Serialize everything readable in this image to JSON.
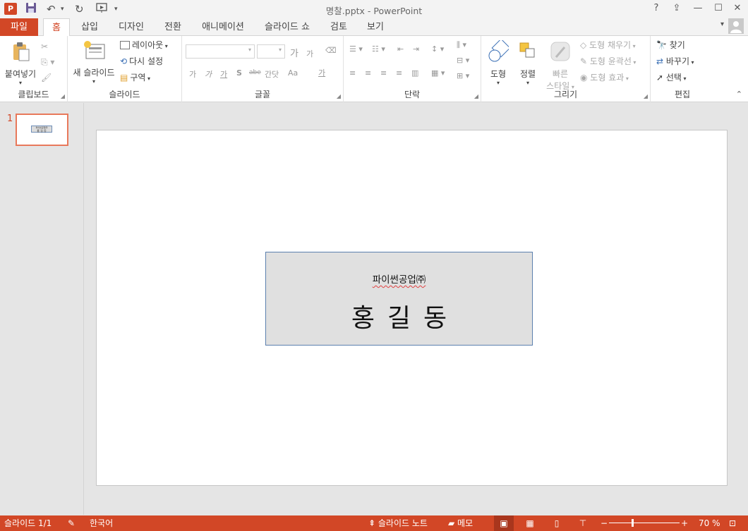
{
  "window": {
    "title": "명찰.pptx - PowerPoint",
    "help": "?",
    "restore_ribbon": "⇪",
    "minimize": "—",
    "maximize": "☐",
    "close": "✕"
  },
  "app_icon_label": "P",
  "qat": {
    "save": "💾",
    "undo": "↶",
    "undo_caret": "▾",
    "redo": "↻",
    "present": "▶",
    "customize": "▾"
  },
  "tabs": {
    "file": "파일",
    "items": [
      "홈",
      "삽입",
      "디자인",
      "전환",
      "애니메이션",
      "슬라이드 쇼",
      "검토",
      "보기"
    ]
  },
  "ribbon": {
    "clipboard": {
      "label": "클립보드",
      "paste": "붙여넣기"
    },
    "slides": {
      "label": "슬라이드",
      "new_slide": "새 슬라이드",
      "layout": "레이아웃",
      "reset": "다시 설정",
      "section": "구역"
    },
    "font": {
      "label": "글꼴",
      "bold": "가",
      "italic": "가",
      "underline": "가",
      "shadow": "S",
      "strike": "abe",
      "spacing": "간닷",
      "case": "Aa",
      "grow": "가",
      "shrink": "가",
      "color": "가"
    },
    "paragraph": {
      "label": "단락"
    },
    "drawing": {
      "label": "그리기",
      "shapes": "도형",
      "arrange": "정렬",
      "quick_styles": [
        "빠른",
        "스타일"
      ],
      "fill": "도형 채우기",
      "outline": "도형 윤곽선",
      "effects": "도형 효과"
    },
    "editing": {
      "label": "편집",
      "find": "찾기",
      "replace": "바꾸기",
      "select": "선택"
    }
  },
  "thumbnails": [
    {
      "number": "1",
      "company": "파이썬공업㈜",
      "name": "홍 길 동"
    }
  ],
  "slide": {
    "company": "파이썬공업㈜",
    "person": "홍길동"
  },
  "statusbar": {
    "slide_info": "슬라이드 1/1",
    "language": "한국어",
    "notes": "슬라이드 노트",
    "comments": "메모",
    "zoom_percent": "70 %"
  },
  "colors": {
    "accent": "#d24726",
    "card_fill": "#e0e0e0",
    "card_border": "#5b7fae"
  }
}
